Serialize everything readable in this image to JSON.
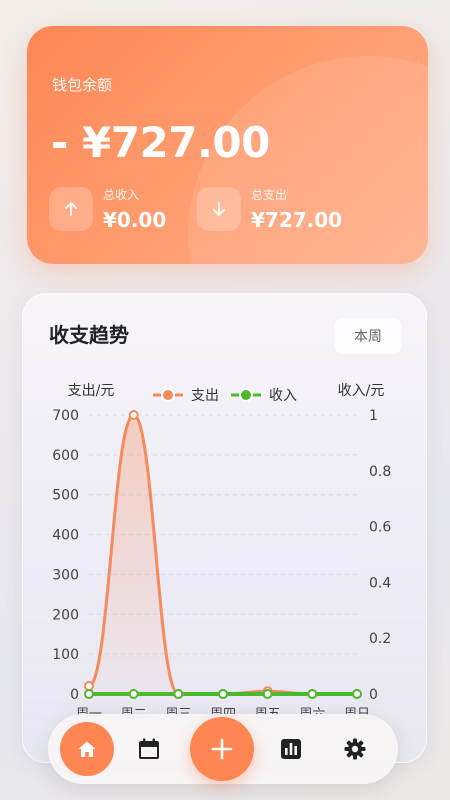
{
  "wallet": {
    "title": "钱包余额",
    "balance": "- ¥727.00",
    "income_label": "总收入",
    "income_value": "¥0.00",
    "expense_label": "总支出",
    "expense_value": "¥727.00",
    "income_icon": "arrow-up-icon",
    "expense_icon": "arrow-down-icon"
  },
  "trend": {
    "title": "收支趋势",
    "period": "本周"
  },
  "chart_data": {
    "type": "line",
    "categories": [
      "周一",
      "周二",
      "周三",
      "周四",
      "周五",
      "周六",
      "周日"
    ],
    "series": [
      {
        "name": "支出",
        "axis": "left",
        "color": "#f58a5c",
        "values": [
          20,
          700,
          0,
          0,
          7,
          0,
          0
        ]
      },
      {
        "name": "收入",
        "axis": "right",
        "color": "#4cb82b",
        "values": [
          0,
          0,
          0,
          0,
          0,
          0,
          0
        ]
      }
    ],
    "ylabel_left": "支出/元",
    "ylabel_right": "收入/元",
    "ylim_left": [
      0,
      700
    ],
    "yticks_left": [
      "700",
      "600",
      "500",
      "400",
      "300",
      "200",
      "100",
      "0"
    ],
    "ylim_right": [
      0,
      1
    ],
    "yticks_right": [
      "1",
      "0.8",
      "0.6",
      "0.4",
      "0.2",
      "0"
    ],
    "legend_position": "top-center",
    "grid": true
  },
  "nav": {
    "items": [
      "home-icon",
      "calendar-icon",
      "add-icon",
      "bar-chart-icon",
      "settings-icon"
    ],
    "accent": "#ff8553"
  },
  "colors": {
    "card_gradient_start": "#ff8655",
    "card_gradient_end": "#ffad88",
    "expense_line": "#f58a5c",
    "income_line": "#4cb82b"
  }
}
